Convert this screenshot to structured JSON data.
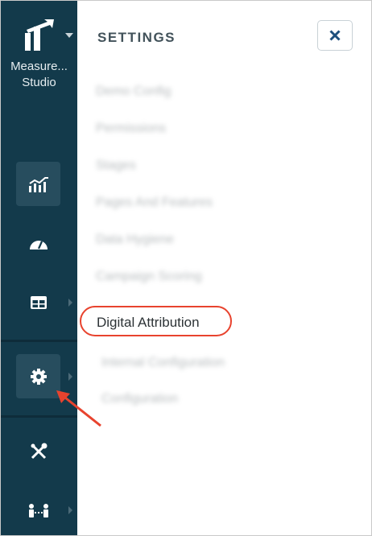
{
  "sidebar": {
    "brand_line1": "Measure...",
    "brand_line2": "Studio",
    "logo_icon": "measure-studio-logo",
    "nav": [
      {
        "icon": "analytics-chart-icon"
      },
      {
        "icon": "gauge-icon"
      },
      {
        "icon": "table-grid-icon"
      },
      {
        "icon": "gear-icon"
      },
      {
        "icon": "tools-icon"
      },
      {
        "icon": "users-connect-icon"
      }
    ]
  },
  "panel": {
    "title": "SETTINGS",
    "close_icon": "close-icon",
    "items": [
      "Demo Config",
      "Permissions",
      "Stages",
      "Pages And Features",
      "Data Hygiene",
      "Campaign Scoring"
    ],
    "highlighted_item": "Digital Attribution",
    "sub_items": [
      "Internal Configuration",
      "Configuration"
    ]
  },
  "colors": {
    "sidebar_bg": "#133a4b",
    "active_bg": "#274d5e",
    "highlight": "#e8432e",
    "close_icon": "#1d4f7c"
  }
}
